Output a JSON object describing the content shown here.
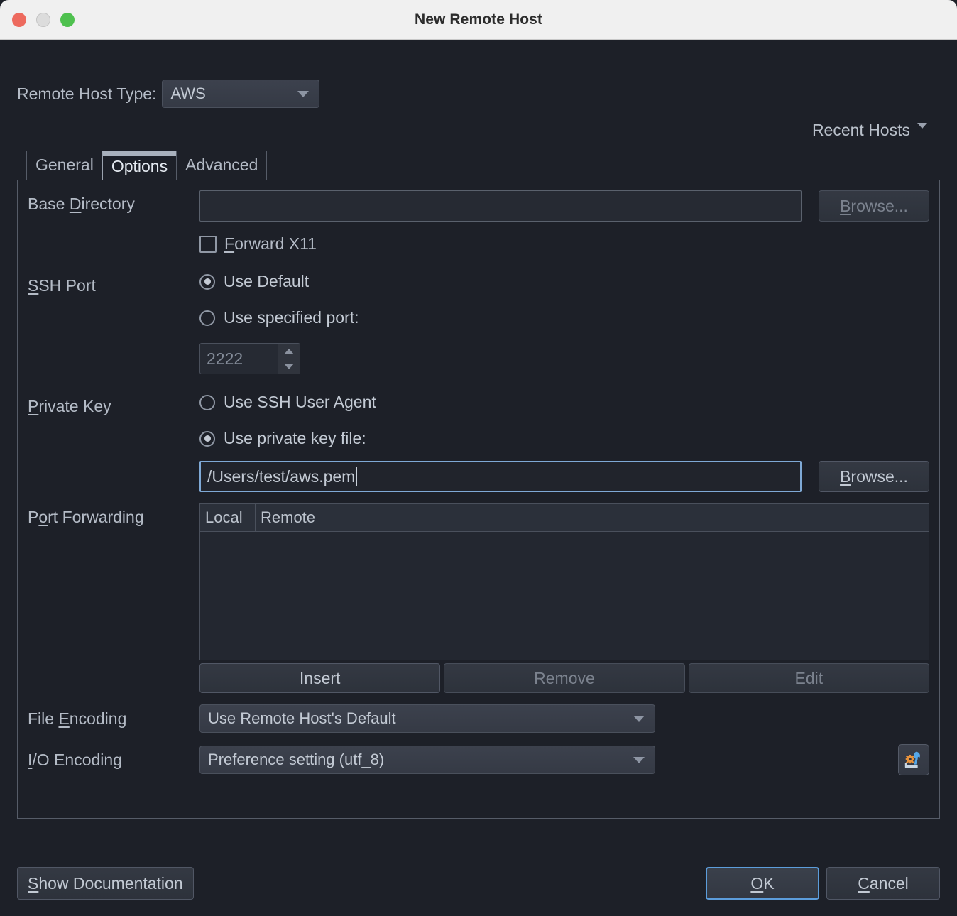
{
  "window": {
    "title": "New Remote Host",
    "traffic_lights": [
      "close-button",
      "minimize-button",
      "maximize-button"
    ]
  },
  "host_type": {
    "label": "Remote Host Type:",
    "value": "AWS",
    "icon": "chevron-down-icon"
  },
  "recent_hosts": {
    "label": "Recent Hosts",
    "icon": "caret-down-icon"
  },
  "tabs": [
    {
      "label": "General",
      "selected": false
    },
    {
      "label": "Options",
      "selected": true
    },
    {
      "label": "Advanced",
      "selected": false
    }
  ],
  "options": {
    "base_directory": {
      "label_pre": "Base ",
      "label_mn": "D",
      "label_post": "irectory",
      "value": "",
      "placeholder": "",
      "browse_label_mn": "B",
      "browse_label_post": "rowse..."
    },
    "forward_x11": {
      "label_pre": "",
      "label_mn": "F",
      "label_post": "orward X11",
      "checked": false
    },
    "ssh_port": {
      "label_pre": "",
      "label_mn": "S",
      "label_post": "SH Port",
      "option_default": "Use Default",
      "option_specified": "Use specified port:",
      "selected": "default",
      "port_value": "2222"
    },
    "private_key": {
      "label_pre": "",
      "label_mn": "P",
      "label_post": "rivate Key",
      "option_agent": "Use SSH User Agent",
      "option_file": "Use private key file:",
      "selected": "file",
      "key_path": "/Users/test/aws.pem",
      "browse_label_mn": "B",
      "browse_label_post": "rowse..."
    },
    "port_forwarding": {
      "label_pre": "P",
      "label_mn": "o",
      "label_post": "rt Forwarding",
      "columns": [
        "Local",
        "Remote"
      ],
      "rows": [],
      "buttons": [
        {
          "label": "Insert",
          "enabled": true
        },
        {
          "label": "Remove",
          "enabled": false
        },
        {
          "label": "Edit",
          "enabled": false
        }
      ]
    },
    "file_encoding": {
      "label_pre": "File ",
      "label_mn": "E",
      "label_post": "ncoding",
      "value": "Use Remote Host's Default",
      "icon": "chevron-down-icon"
    },
    "io_encoding": {
      "label_pre": "",
      "label_mn": "I",
      "label_post": "/O Encoding",
      "value": "Preference setting (utf_8)",
      "icon": "chevron-down-icon",
      "settings_icon": "gear-wrench-icon"
    }
  },
  "footer": {
    "show_documentation_mn": "S",
    "show_documentation_post": "how Documentation",
    "ok_mn": "O",
    "ok_post": "K",
    "cancel_mn": "C",
    "cancel_post": "ancel"
  },
  "colors": {
    "background": "#1d2028",
    "titlebar": "#f0f0f0",
    "accent_focus": "#5c9ddb",
    "text": "#b4bbc6",
    "close": "#ed6a5e",
    "minimize": "#dcdcdc",
    "maximize": "#4fc14f",
    "gear_icon": "#e8933c",
    "wrench_icon": "#56a8e8"
  }
}
